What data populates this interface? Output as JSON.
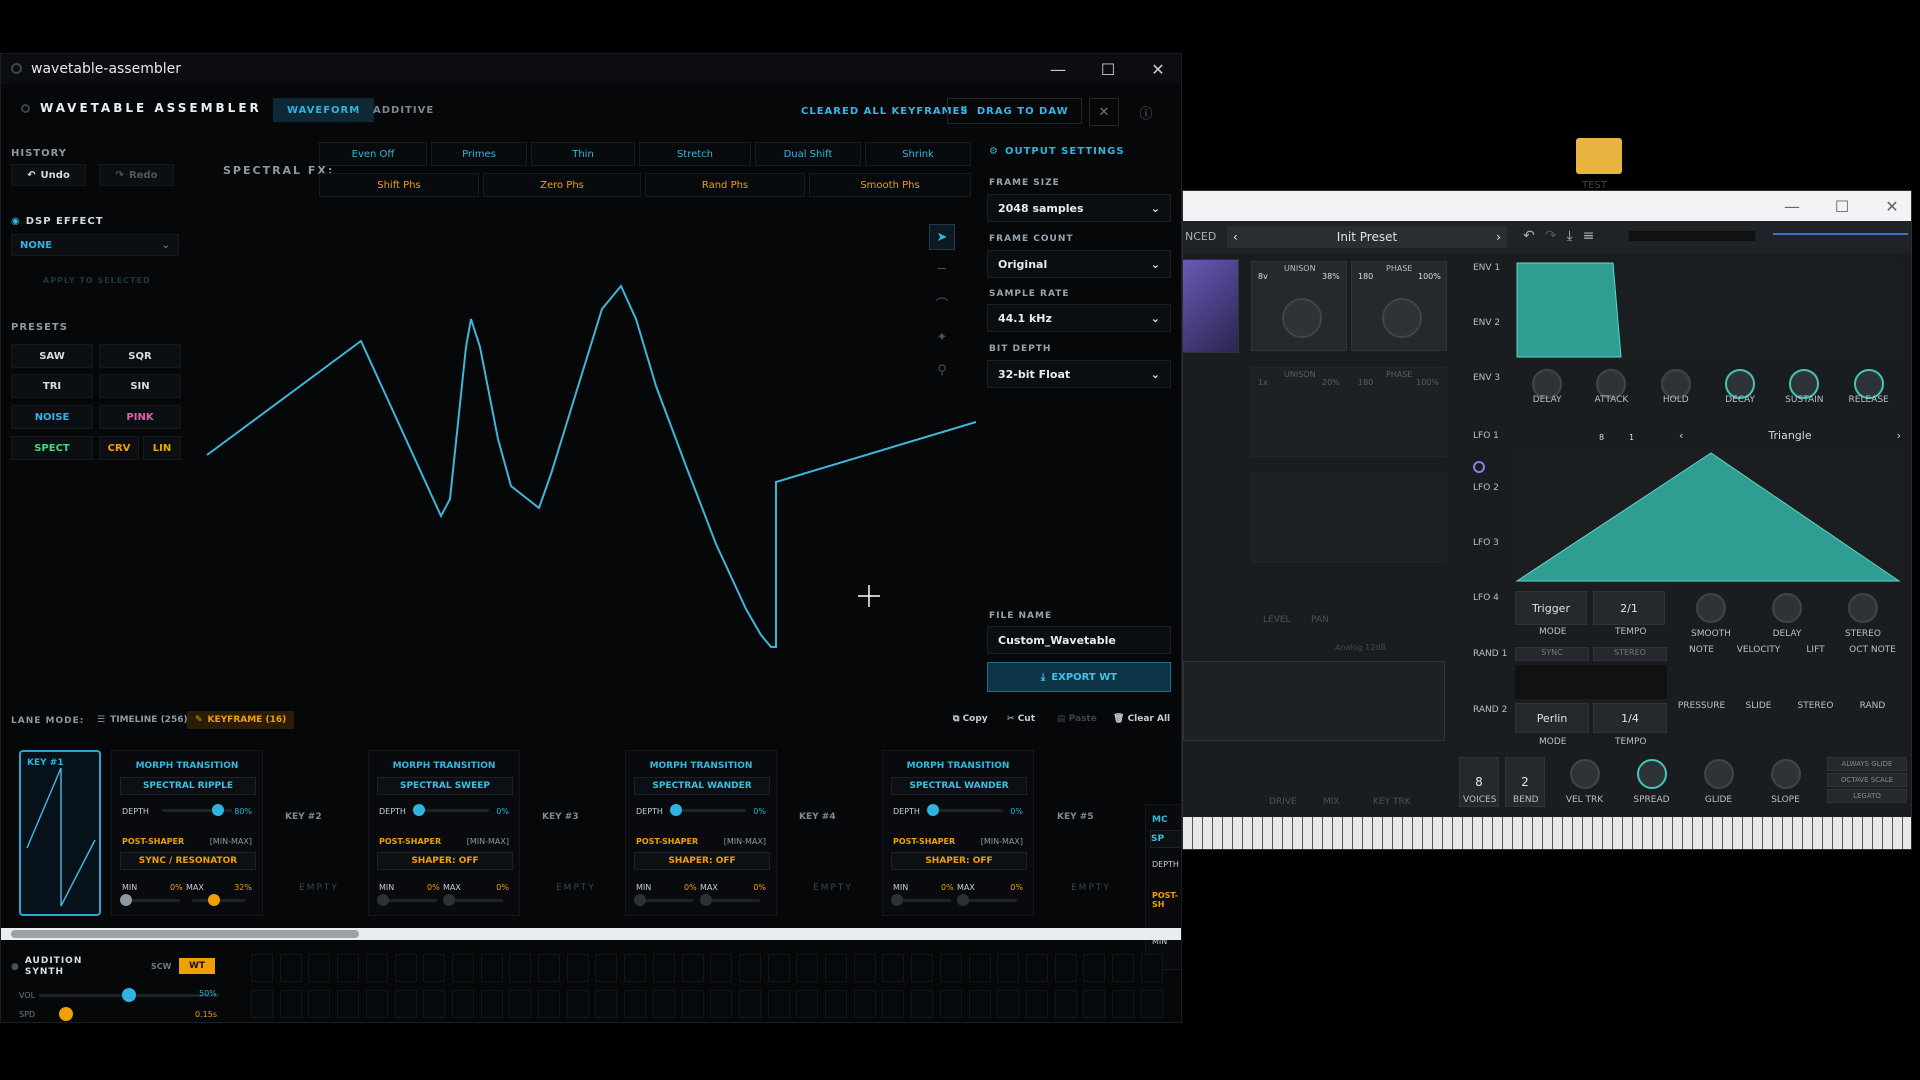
{
  "app": {
    "window_title": "wavetable-assembler",
    "logo_text": "WAVETABLE ASSEMBLER",
    "tabs": [
      {
        "label": "WAVEFORM",
        "active": true
      },
      {
        "label": "ADDITIVE",
        "active": false
      }
    ],
    "cleared_msg": "CLEARED ALL KEYFRAMES",
    "drag_to_daw": "DRAG TO DAW",
    "accent": "#2fb4e0"
  },
  "history": {
    "title": "HISTORY",
    "undo": "Undo",
    "redo": "Redo"
  },
  "dsp": {
    "title": "DSP EFFECT",
    "value": "NONE",
    "apply": "APPLY TO SELECTED"
  },
  "presets": {
    "title": "PRESETS",
    "items": [
      {
        "label": "SAW",
        "color": "#e6ecf2"
      },
      {
        "label": "SQR",
        "color": "#e6ecf2"
      },
      {
        "label": "TRI",
        "color": "#e6ecf2"
      },
      {
        "label": "SIN",
        "color": "#e6ecf2"
      },
      {
        "label": "NOISE",
        "color": "#31b6e3"
      },
      {
        "label": "PINK",
        "color": "#e35fb0"
      },
      {
        "label": "SPECT",
        "color": "#47d68b"
      },
      {
        "label": "CRV",
        "color": "#f2a200"
      },
      {
        "label": "LIN",
        "color": "#f2a200"
      }
    ]
  },
  "spectral_fx": {
    "title": "SPECTRAL FX:",
    "row1": [
      "Even Off",
      "Primes",
      "Thin",
      "Stretch",
      "Dual Shift",
      "Shrink"
    ],
    "row2": [
      "Shift Phs",
      "Zero Phs",
      "Rand Phs",
      "Smooth Phs"
    ]
  },
  "output": {
    "title": "OUTPUT SETTINGS",
    "frame_size_label": "FRAME SIZE",
    "frame_size": "2048 samples",
    "frame_count_label": "FRAME COUNT",
    "frame_count": "Original",
    "sample_rate_label": "SAMPLE RATE",
    "sample_rate": "44.1 kHz",
    "bit_depth_label": "BIT DEPTH",
    "bit_depth": "32-bit Float",
    "file_name_label": "FILE NAME",
    "file_name": "Custom_Wavetable",
    "export": "EXPORT WT"
  },
  "lane": {
    "mode_label": "LANE MODE:",
    "timeline": "TIMELINE (256)",
    "keyframe": "KEYFRAME (16)",
    "copy": "Copy",
    "cut": "Cut",
    "paste": "Paste",
    "clear_all": "Clear All"
  },
  "keyframes": [
    {
      "key": "KEY #1"
    },
    {
      "key": "KEY #2",
      "empty": "EMPTY"
    },
    {
      "key": "KEY #3",
      "empty": "EMPTY"
    },
    {
      "key": "KEY #4",
      "empty": "EMPTY"
    },
    {
      "key": "KEY #5",
      "empty": "EMPTY"
    }
  ],
  "transitions": [
    {
      "title": "MORPH TRANSITION",
      "mode": "SPECTRAL RIPPLE",
      "depth_label": "DEPTH",
      "depth": "80%",
      "depth_value": 0.8,
      "post": "POST-SHAPER",
      "range": "[MIN-MAX]",
      "shaper": "SYNC / RESONATOR",
      "min_label": "MIN",
      "min": "0%",
      "max_label": "MAX",
      "max": "32%"
    },
    {
      "title": "MORPH TRANSITION",
      "mode": "SPECTRAL SWEEP",
      "depth_label": "DEPTH",
      "depth": "0%",
      "depth_value": 0,
      "post": "POST-SHAPER",
      "range": "[MIN-MAX]",
      "shaper": "SHAPER: OFF",
      "min_label": "MIN",
      "min": "0%",
      "max_label": "MAX",
      "max": "0%"
    },
    {
      "title": "MORPH TRANSITION",
      "mode": "SPECTRAL WANDER",
      "depth_label": "DEPTH",
      "depth": "0%",
      "depth_value": 0,
      "post": "POST-SHAPER",
      "range": "[MIN-MAX]",
      "shaper": "SHAPER: OFF",
      "min_label": "MIN",
      "min": "0%",
      "max_label": "MAX",
      "max": "0%"
    },
    {
      "title": "MORPH TRANSITION",
      "mode": "SPECTRAL WANDER",
      "depth_label": "DEPTH",
      "depth": "0%",
      "depth_value": 0,
      "post": "POST-SHAPER",
      "range": "[MIN-MAX]",
      "shaper": "SHAPER: OFF",
      "min_label": "MIN",
      "min": "0%",
      "max_label": "MAX",
      "max": "0%"
    }
  ],
  "partial_card": {
    "title": "MC",
    "mode": "SP",
    "depth_label": "DEPTH",
    "post": "POST-SH",
    "min_label": "MIN"
  },
  "audition": {
    "title": "AUDITION SYNTH",
    "scw": "SCW",
    "wt": "WT",
    "vol_label": "VOL",
    "vol": "50%",
    "vol_value": 0.5,
    "spd_label": "SPD",
    "spd": "0.15s"
  },
  "synth": {
    "mode_tab": "NCED",
    "preset": "Init Preset",
    "osc": {
      "oct": "8v",
      "unison_label": "UNISON",
      "unison": "38%",
      "phase_label": "PHASE",
      "phase_val": "180",
      "phase_pct": "100%"
    },
    "osc_dim": {
      "oct": "1x",
      "unison_label": "UNISON",
      "unison": "20%",
      "phase_label": "PHASE",
      "phase_val": "180",
      "phase_pct": "100%"
    },
    "level": "LEVEL",
    "pan": "PAN",
    "filter": "Analog 12dB",
    "drive": "DRIVE",
    "mix": "MIX",
    "keytrk": "KEY TRK",
    "env_tabs": [
      "ENV 1",
      "ENV 2",
      "ENV 3"
    ],
    "env_knobs": [
      "DELAY",
      "ATTACK",
      "HOLD",
      "DECAY",
      "SUSTAIN",
      "RELEASE"
    ],
    "lfo_tabs": [
      "LFO 1",
      "LFO 2",
      "LFO 3",
      "LFO 4"
    ],
    "lfo_shape": "Triangle",
    "lfo_grid": "8",
    "lfo_div": "1",
    "lfo_mode": "Trigger",
    "lfo_mode_label": "MODE",
    "lfo_tempo": "2/1",
    "lfo_tempo_label": "TEMPO",
    "lfo_knobs": [
      "SMOOTH",
      "DELAY",
      "STEREO"
    ],
    "rand_tabs": [
      "RAND 1",
      "RAND 2"
    ],
    "rand_sync": "SYNC",
    "rand_stereo": "STEREO",
    "rand_mode": "Perlin",
    "rand_mode_label": "MODE",
    "rand_tempo": "1/4",
    "rand_tempo_label": "TEMPO",
    "mod_src_row1": [
      "NOTE",
      "VELOCITY",
      "LIFT",
      "OCT NOTE"
    ],
    "mod_src_row2": [
      "PRESSURE",
      "SLIDE",
      "STEREO",
      "RAND"
    ],
    "voices": "8",
    "voices_label": "VOICES",
    "bend": "2",
    "bend_label": "BEND",
    "bottom_knobs": [
      "VEL TRK",
      "SPREAD",
      "GLIDE",
      "SLOPE"
    ],
    "glide_opts": [
      "ALWAYS GLIDE",
      "OCTAVE SCALE",
      "LEGATO"
    ],
    "teal": "#3fbfae"
  },
  "desktop_label": "TEST"
}
